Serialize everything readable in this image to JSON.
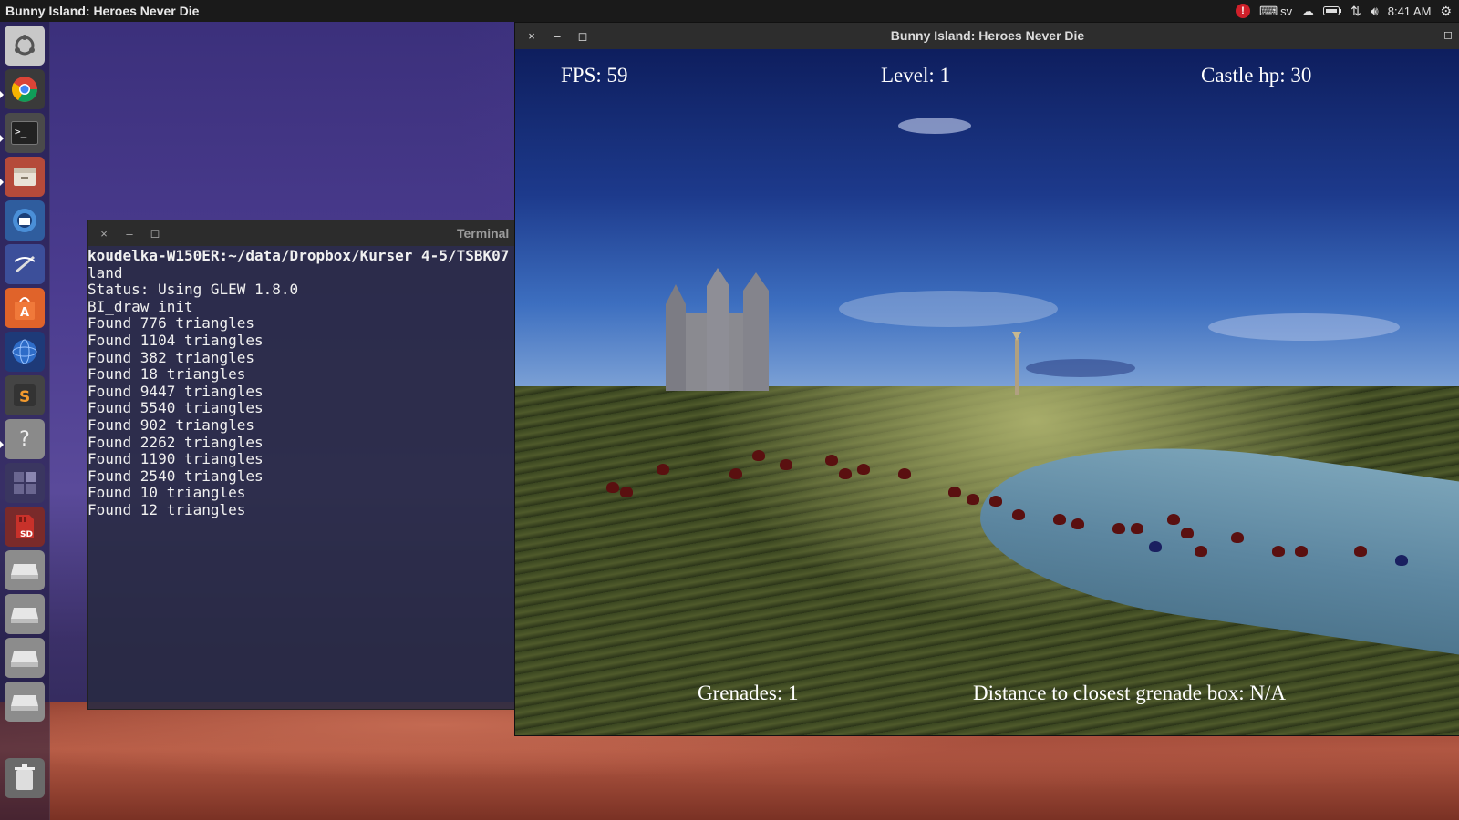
{
  "top_panel": {
    "active_app_title": "Bunny Island: Heroes Never Die",
    "keyboard_layout": "sv",
    "clock": "8:41 AM"
  },
  "icons": {
    "alert": "alert-icon",
    "keyboard": "keyboard-icon",
    "cloud": "cloud-icon",
    "battery": "battery-icon",
    "network": "network-icon",
    "volume": "volume-icon",
    "settings": "gear-icon"
  },
  "launcher": {
    "items": [
      {
        "name": "dash-home",
        "icon": "ubuntu-logo-icon"
      },
      {
        "name": "chrome",
        "icon": "chrome-icon"
      },
      {
        "name": "terminal",
        "icon": "terminal-icon"
      },
      {
        "name": "files",
        "icon": "files-icon"
      },
      {
        "name": "thunderbird",
        "icon": "mail-icon"
      },
      {
        "name": "text-editor",
        "icon": "editor-icon"
      },
      {
        "name": "software-center",
        "icon": "software-center-icon"
      },
      {
        "name": "browser",
        "icon": "globe-icon"
      },
      {
        "name": "sublime-text",
        "icon": "sublime-icon"
      },
      {
        "name": "help",
        "icon": "help-icon"
      },
      {
        "name": "workspaces",
        "icon": "workspaces-icon"
      },
      {
        "name": "sd-card",
        "icon": "sd-card-icon",
        "label": "SD"
      },
      {
        "name": "drive-1",
        "icon": "drive-icon"
      },
      {
        "name": "drive-2",
        "icon": "drive-icon"
      },
      {
        "name": "drive-3",
        "icon": "drive-icon"
      },
      {
        "name": "drive-4",
        "icon": "drive-icon"
      },
      {
        "name": "trash",
        "icon": "trash-icon"
      }
    ]
  },
  "terminal": {
    "title": "Terminal",
    "prompt": "koudelka-W150ER:~/data/Dropbox/Kurser 4-5/TSBK07",
    "lines": [
      "land",
      "Status: Using GLEW 1.8.0",
      "BI_draw init",
      "",
      "",
      "Found 776 triangles",
      "Found 1104 triangles",
      "Found 382 triangles",
      "Found 18 triangles",
      "Found 9447 triangles",
      "Found 5540 triangles",
      "Found 902 triangles",
      "Found 2262 triangles",
      "Found 1190 triangles",
      "Found 2540 triangles",
      "Found 10 triangles",
      "Found 12 triangles"
    ]
  },
  "game_window": {
    "title": "Bunny Island: Heroes Never Die",
    "hud": {
      "fps": "FPS: 59",
      "level": "Level: 1",
      "castle_hp": "Castle hp: 30",
      "grenades": "Grenades: 1",
      "distance": "Distance to closest grenade box: N/A"
    }
  },
  "window_controls": {
    "close": "×",
    "minimize": "–",
    "maximize": "◻"
  }
}
